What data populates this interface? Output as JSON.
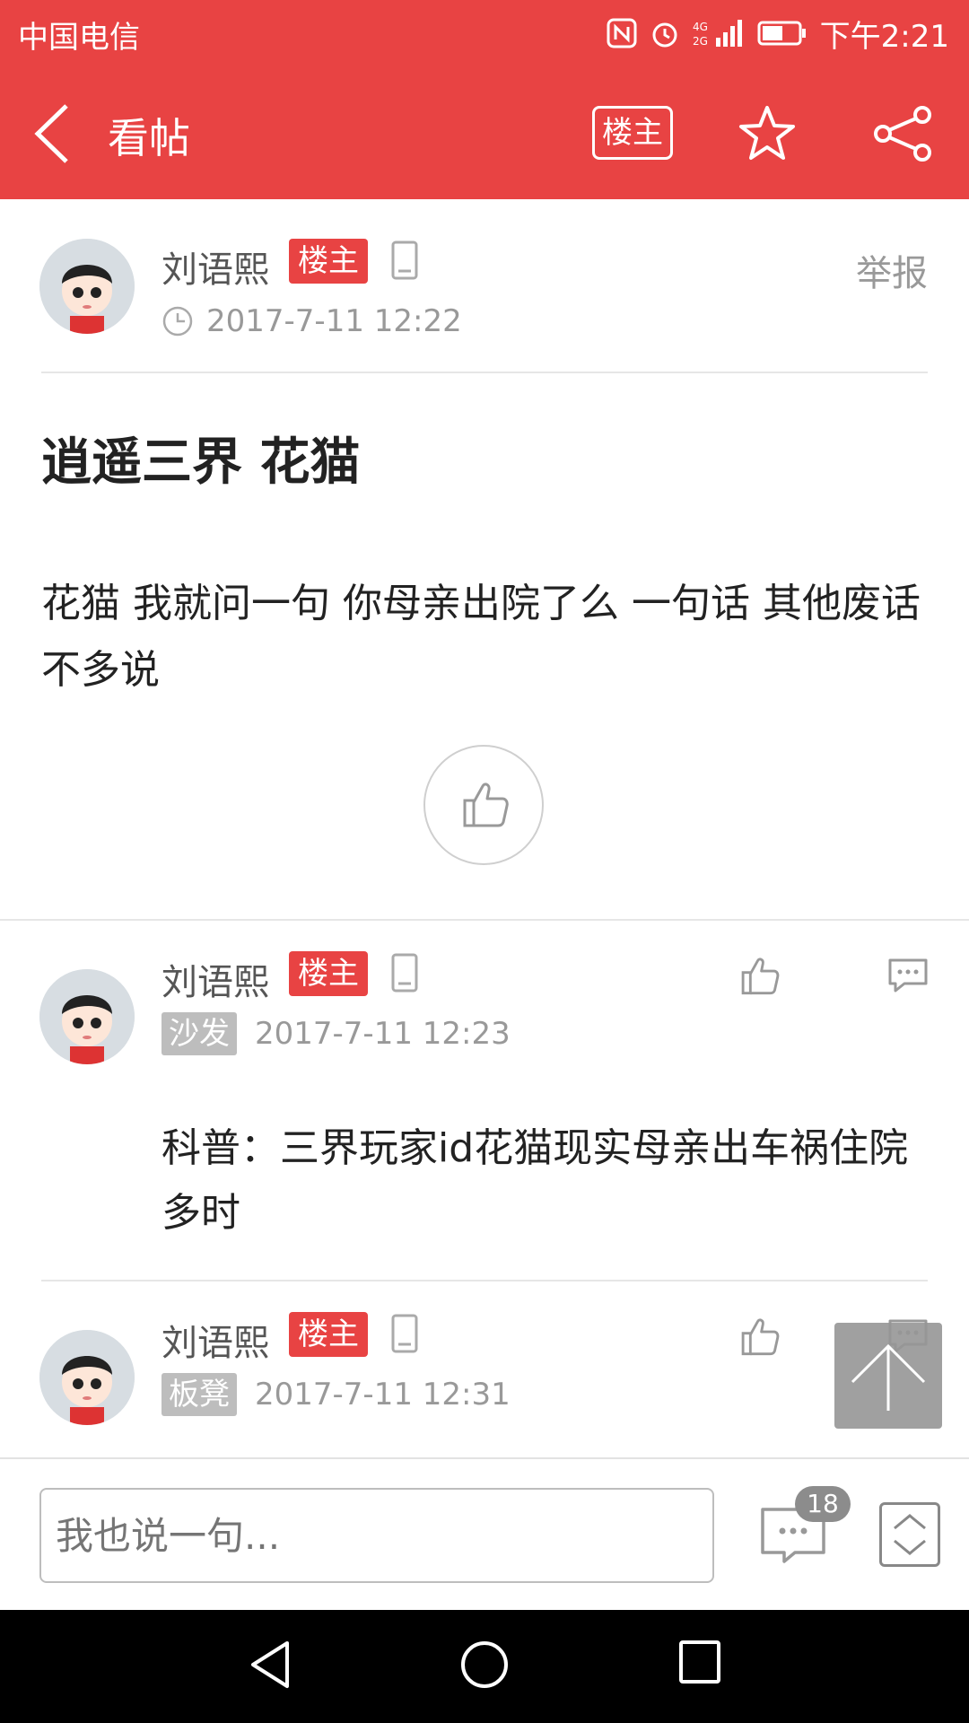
{
  "status_bar": {
    "carrier": "中国电信",
    "time": "下午2:21"
  },
  "header": {
    "title": "看帖",
    "owner_button": "楼主"
  },
  "post": {
    "author": "刘语熙",
    "owner_tag": "楼主",
    "time": "2017-7-11 12:22",
    "report": "举报",
    "title": "逍遥三界 花猫",
    "body": "花猫 我就问一句 你母亲出院了么 一句话 其他废话不多说"
  },
  "replies": [
    {
      "author": "刘语熙",
      "owner_tag": "楼主",
      "floor": "沙发",
      "time": "2017-7-11 12:23",
      "text": "科普：三界玩家id花猫现实母亲出车祸住院多时"
    },
    {
      "author": "刘语熙",
      "owner_tag": "楼主",
      "floor": "板凳",
      "time": "2017-7-11 12:31"
    }
  ],
  "bottom_bar": {
    "input_placeholder": "我也说一句...",
    "comment_count": "18"
  },
  "colors": {
    "accent": "#e84343",
    "tag_gray": "#bdbdbd",
    "nav_bg": "#000000"
  }
}
